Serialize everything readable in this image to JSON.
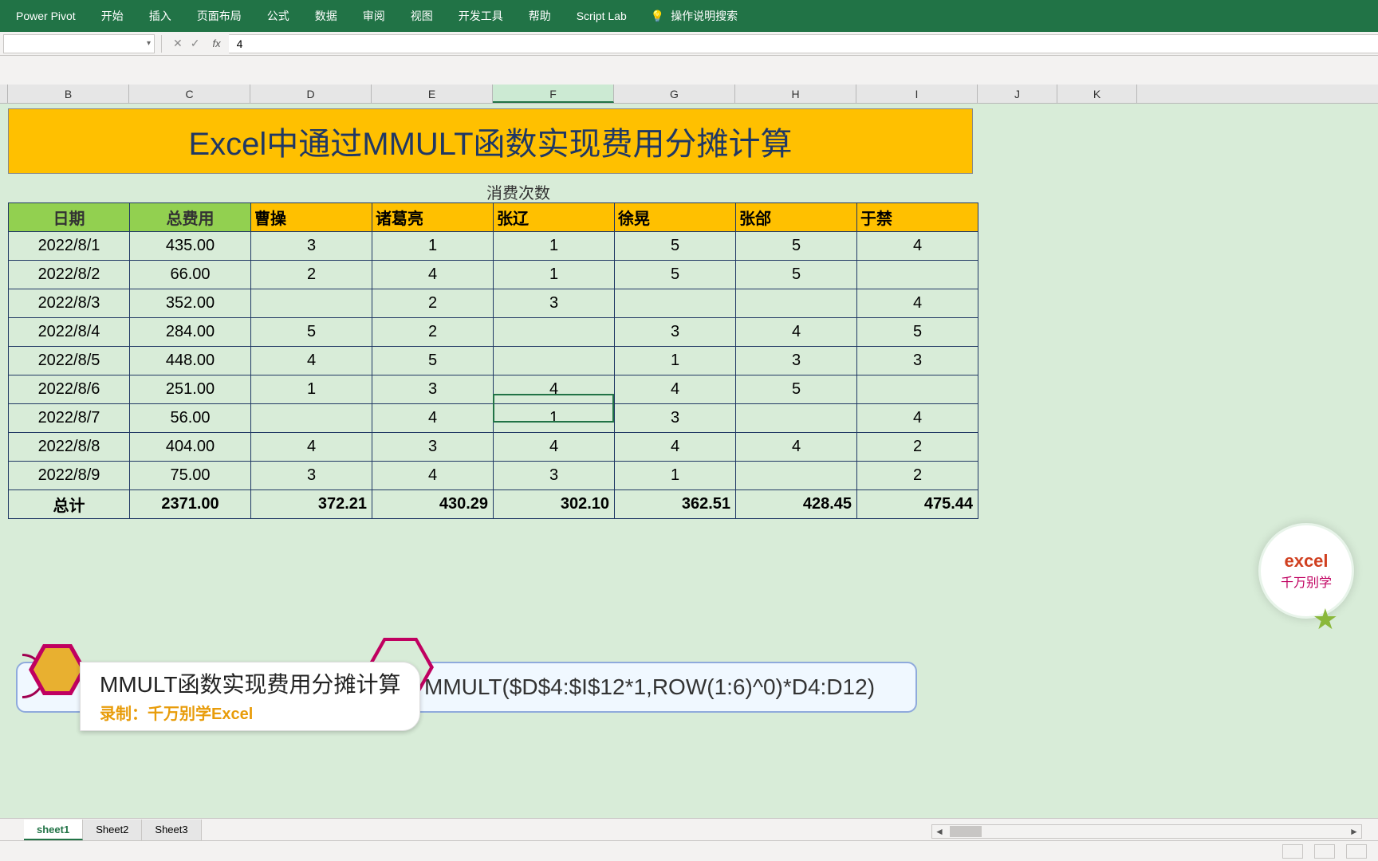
{
  "ribbon": {
    "tabs": [
      "Power Pivot",
      "开始",
      "插入",
      "页面布局",
      "公式",
      "数据",
      "审阅",
      "视图",
      "开发工具",
      "帮助",
      "Script Lab"
    ],
    "search_hint": "操作说明搜索"
  },
  "name_box": "",
  "formula_bar_value": "4",
  "columns": [
    "B",
    "C",
    "D",
    "E",
    "F",
    "G",
    "H",
    "I",
    "J",
    "K"
  ],
  "selected_column": "F",
  "title_text": "Excel中通过MMULT函数实现费用分摊计算",
  "subtitle": "消费次数",
  "headers": {
    "date": "日期",
    "cost": "总费用",
    "people": [
      "曹操",
      "诸葛亮",
      "张辽",
      "徐晃",
      "张郃",
      "于禁"
    ]
  },
  "rows": [
    {
      "date": "2022/8/1",
      "cost": "435.00",
      "v": [
        "3",
        "1",
        "1",
        "5",
        "5",
        "4"
      ]
    },
    {
      "date": "2022/8/2",
      "cost": "66.00",
      "v": [
        "2",
        "4",
        "1",
        "5",
        "5",
        ""
      ]
    },
    {
      "date": "2022/8/3",
      "cost": "352.00",
      "v": [
        "",
        "2",
        "3",
        "",
        "",
        "4"
      ]
    },
    {
      "date": "2022/8/4",
      "cost": "284.00",
      "v": [
        "5",
        "2",
        "",
        "3",
        "4",
        "5"
      ]
    },
    {
      "date": "2022/8/5",
      "cost": "448.00",
      "v": [
        "4",
        "5",
        "",
        "1",
        "3",
        "3"
      ]
    },
    {
      "date": "2022/8/6",
      "cost": "251.00",
      "v": [
        "1",
        "3",
        "4",
        "4",
        "5",
        ""
      ]
    },
    {
      "date": "2022/8/7",
      "cost": "56.00",
      "v": [
        "",
        "4",
        "1",
        "3",
        "",
        "4"
      ]
    },
    {
      "date": "2022/8/8",
      "cost": "404.00",
      "v": [
        "4",
        "3",
        "4",
        "4",
        "4",
        "2"
      ]
    },
    {
      "date": "2022/8/9",
      "cost": "75.00",
      "v": [
        "3",
        "4",
        "3",
        "1",
        "",
        "2"
      ]
    }
  ],
  "total": {
    "label": "总计",
    "cost": "2371.00",
    "v": [
      "372.21",
      "430.29",
      "302.10",
      "362.51",
      "428.45",
      "475.44"
    ]
  },
  "callout": {
    "formula_visible": "MMULT($D$4:$I$12*1,ROW(1:6)^0)*D4:D12)",
    "box_title": "MMULT函数实现费用分摊计算",
    "box_sub": "录制：千万别学Excel"
  },
  "watermark": {
    "line1": "excel",
    "line2": "千万别学"
  },
  "sheet_tabs": [
    "sheet1",
    "Sheet2",
    "Sheet3"
  ],
  "active_sheet": 0,
  "fx_label": "fx"
}
